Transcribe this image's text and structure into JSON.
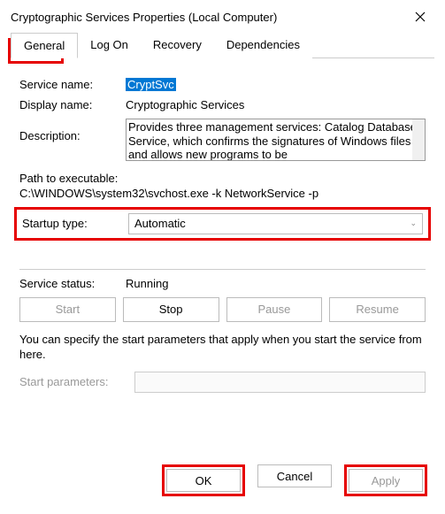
{
  "window": {
    "title": "Cryptographic Services Properties (Local Computer)"
  },
  "tabs": {
    "general": "General",
    "logon": "Log On",
    "recovery": "Recovery",
    "dependencies": "Dependencies"
  },
  "labels": {
    "service_name": "Service name:",
    "display_name": "Display name:",
    "description": "Description:",
    "path_label": "Path to executable:",
    "startup_type": "Startup type:",
    "service_status": "Service status:",
    "start_parameters": "Start parameters:"
  },
  "values": {
    "service_name": "CryptSvc",
    "display_name": "Cryptographic Services",
    "description": "Provides three management services: Catalog Database Service, which confirms the signatures of Windows files and allows new programs to be",
    "path": "C:\\WINDOWS\\system32\\svchost.exe -k NetworkService -p",
    "startup_type": "Automatic",
    "service_status": "Running",
    "start_parameters": ""
  },
  "buttons": {
    "start": "Start",
    "stop": "Stop",
    "pause": "Pause",
    "resume": "Resume",
    "ok": "OK",
    "cancel": "Cancel",
    "apply": "Apply"
  },
  "hint": "You can specify the start parameters that apply when you start the service from here."
}
